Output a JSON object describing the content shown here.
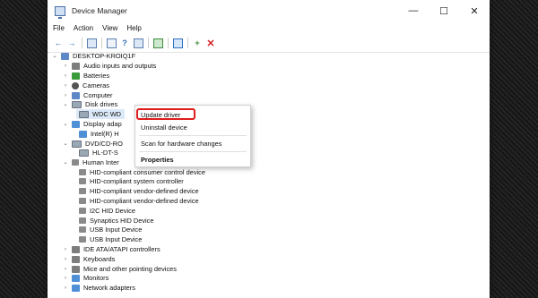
{
  "window": {
    "title": "Device Manager",
    "minimize": "—",
    "maximize": "☐",
    "close": "✕"
  },
  "menu": [
    "File",
    "Action",
    "View",
    "Help"
  ],
  "tree": [
    {
      "label": "DESKTOP-KROIQ1F",
      "arrow": "⌄"
    },
    {
      "label": "Audio inputs and outputs",
      "arrow": "›"
    },
    {
      "label": "Batteries",
      "arrow": "›"
    },
    {
      "label": "Cameras",
      "arrow": "›"
    },
    {
      "label": "Computer",
      "arrow": "›"
    },
    {
      "label": "Disk drives",
      "arrow": "⌄"
    },
    {
      "label": "WDC WD",
      "arrow": ""
    },
    {
      "label": "Display adap",
      "arrow": "⌄"
    },
    {
      "label": "Intel(R) H",
      "arrow": ""
    },
    {
      "label": "DVD/CD-RO",
      "arrow": "⌄"
    },
    {
      "label": "HL-DT-S",
      "arrow": ""
    },
    {
      "label": "Human Inter",
      "arrow": "⌄"
    },
    {
      "label": "HID-compliant consumer control device",
      "arrow": ""
    },
    {
      "label": "HID-compliant system controller",
      "arrow": ""
    },
    {
      "label": "HID-compliant vendor-defined device",
      "arrow": ""
    },
    {
      "label": "HID-compliant vendor-defined device",
      "arrow": ""
    },
    {
      "label": "I2C HID Device",
      "arrow": ""
    },
    {
      "label": "Synaptics HID Device",
      "arrow": ""
    },
    {
      "label": "USB Input Device",
      "arrow": ""
    },
    {
      "label": "USB Input Device",
      "arrow": ""
    },
    {
      "label": "IDE ATA/ATAPI controllers",
      "arrow": "›"
    },
    {
      "label": "Keyboards",
      "arrow": "›"
    },
    {
      "label": "Mice and other pointing devices",
      "arrow": "›"
    },
    {
      "label": "Monitors",
      "arrow": "›"
    },
    {
      "label": "Network adapters",
      "arrow": "›"
    }
  ],
  "context_menu": {
    "update_driver": "Update driver",
    "uninstall_device": "Uninstall device",
    "scan": "Scan for hardware changes",
    "properties": "Properties"
  },
  "colors": {
    "highlight": "#e01b1b",
    "uninstall_x": "#d32020"
  }
}
